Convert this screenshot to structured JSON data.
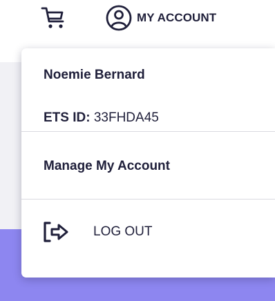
{
  "header": {
    "cart_icon": "shopping-cart-icon",
    "account_icon": "user-circle-icon",
    "account_label": "MY ACCOUNT"
  },
  "menu": {
    "user_name": "Noemie Bernard",
    "ets_label": "ETS ID:",
    "ets_value": "33FHDA45",
    "manage_label": "Manage My Account",
    "logout_icon": "logout-icon",
    "logout_label": "LOG OUT"
  },
  "colors": {
    "text": "#1f1f3a",
    "page_background": "#f1f1f5",
    "accent_band": "#8d86f0",
    "divider": "#d9d9e0"
  }
}
